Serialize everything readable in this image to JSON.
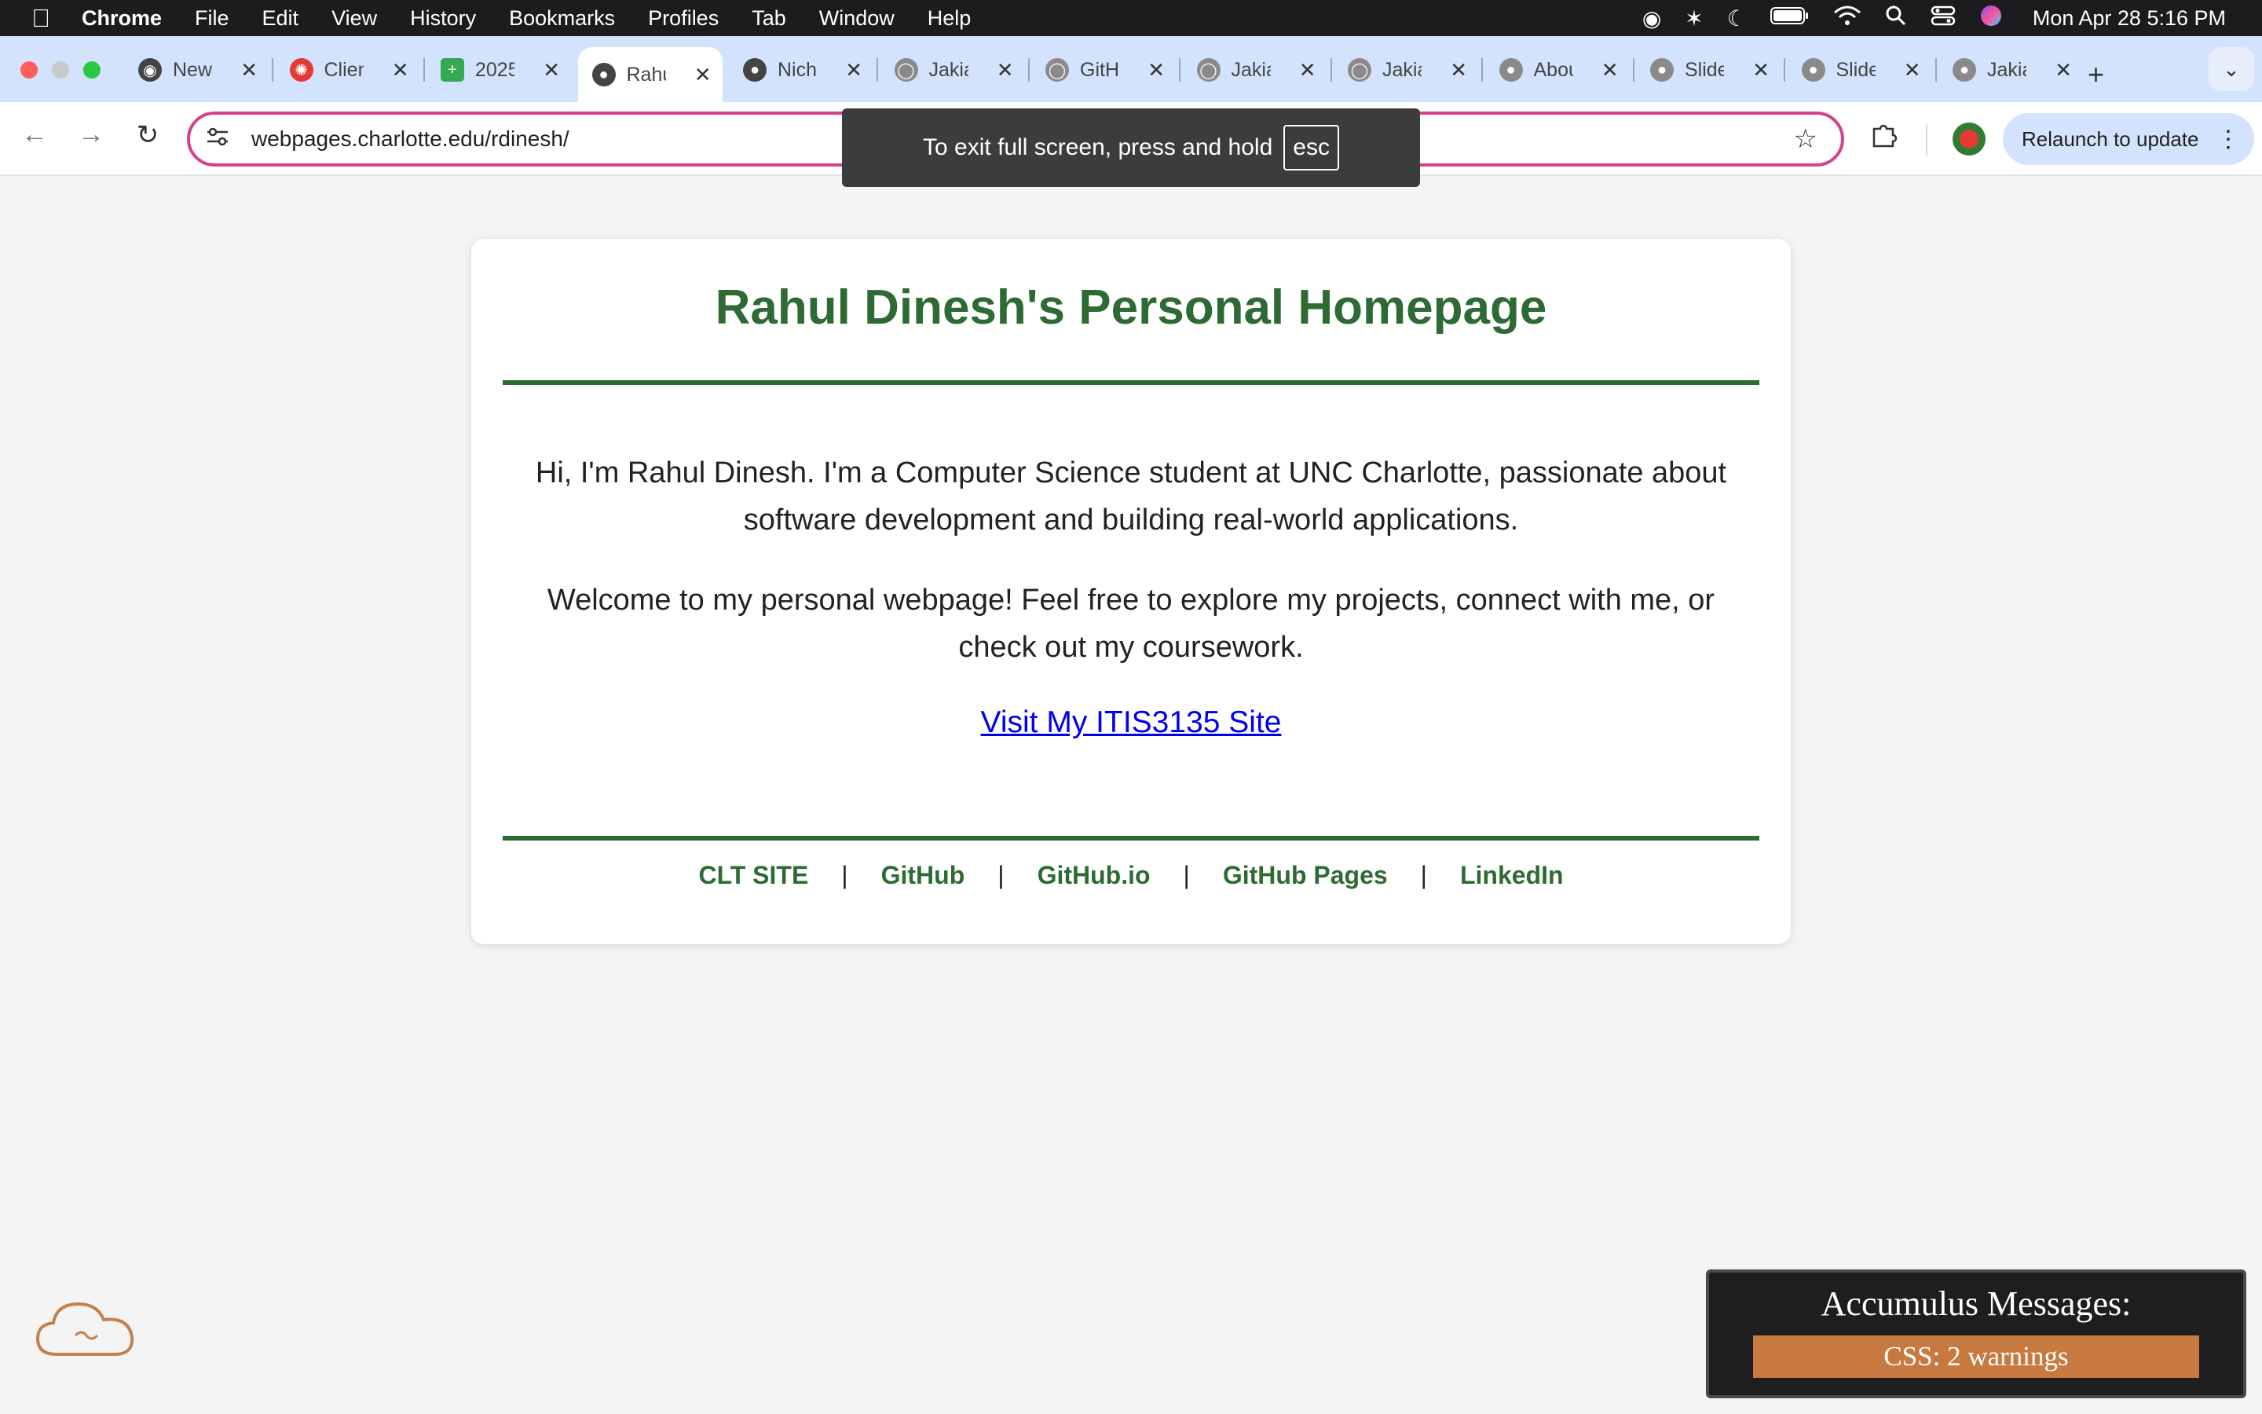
{
  "menubar": {
    "app": "Chrome",
    "items": [
      "File",
      "Edit",
      "View",
      "History",
      "Bookmarks",
      "Profiles",
      "Tab",
      "Window",
      "Help"
    ],
    "clock": "Mon Apr 28  5:16 PM"
  },
  "tabs": [
    {
      "label": "New",
      "icon": "chrome-icon",
      "color": "#444444"
    },
    {
      "label": "Clien",
      "icon": "canvas-icon",
      "color": "#e53935"
    },
    {
      "label": "2025",
      "icon": "sheets-icon",
      "color": "#34a853"
    },
    {
      "label": "Rahu",
      "icon": "globe-icon",
      "color": "#444444"
    },
    {
      "label": "Nich",
      "icon": "globe-icon",
      "color": "#444444"
    },
    {
      "label": "Jakia",
      "icon": "loading-icon",
      "color": "#8a8a8a"
    },
    {
      "label": "GitH",
      "icon": "github-icon",
      "color": "#8a8a8a"
    },
    {
      "label": "Jakia",
      "icon": "loading-icon",
      "color": "#8a8a8a"
    },
    {
      "label": "Jakia",
      "icon": "loading-icon",
      "color": "#8a8a8a"
    },
    {
      "label": "Abou",
      "icon": "globe-icon",
      "color": "#8a8a8a"
    },
    {
      "label": "Slide",
      "icon": "globe-icon",
      "color": "#8a8a8a"
    },
    {
      "label": "Slide",
      "icon": "globe-icon",
      "color": "#8a8a8a"
    },
    {
      "label": "Jakia",
      "icon": "globe-icon",
      "color": "#8a8a8a"
    }
  ],
  "active_tab": "Rahu",
  "toolbar": {
    "url": "webpages.charlotte.edu/rdinesh/",
    "relaunch_label": "Relaunch to update"
  },
  "fullscreen_toast": {
    "message": "To exit full screen, press and hold",
    "key": "esc"
  },
  "page": {
    "title": "Rahul Dinesh's Personal Homepage",
    "intro_1": "Hi, I'm Rahul Dinesh. I'm a Computer Science student at UNC Charlotte, passionate about software development and building real-world applications.",
    "intro_2": "Welcome to my personal webpage! Feel free to explore my projects, connect with me, or check out my coursework.",
    "site_link": "Visit My ITIS3135 Site",
    "footer_links": [
      "CLT SITE",
      "GitHub",
      "GitHub.io",
      "GitHub Pages",
      "LinkedIn"
    ],
    "separator": "|",
    "accent_color": "#2e6b34",
    "link_color": "#0000ee"
  },
  "accumulus": {
    "title": "Accumulus Messages:",
    "warning": "CSS: 2 warnings"
  }
}
